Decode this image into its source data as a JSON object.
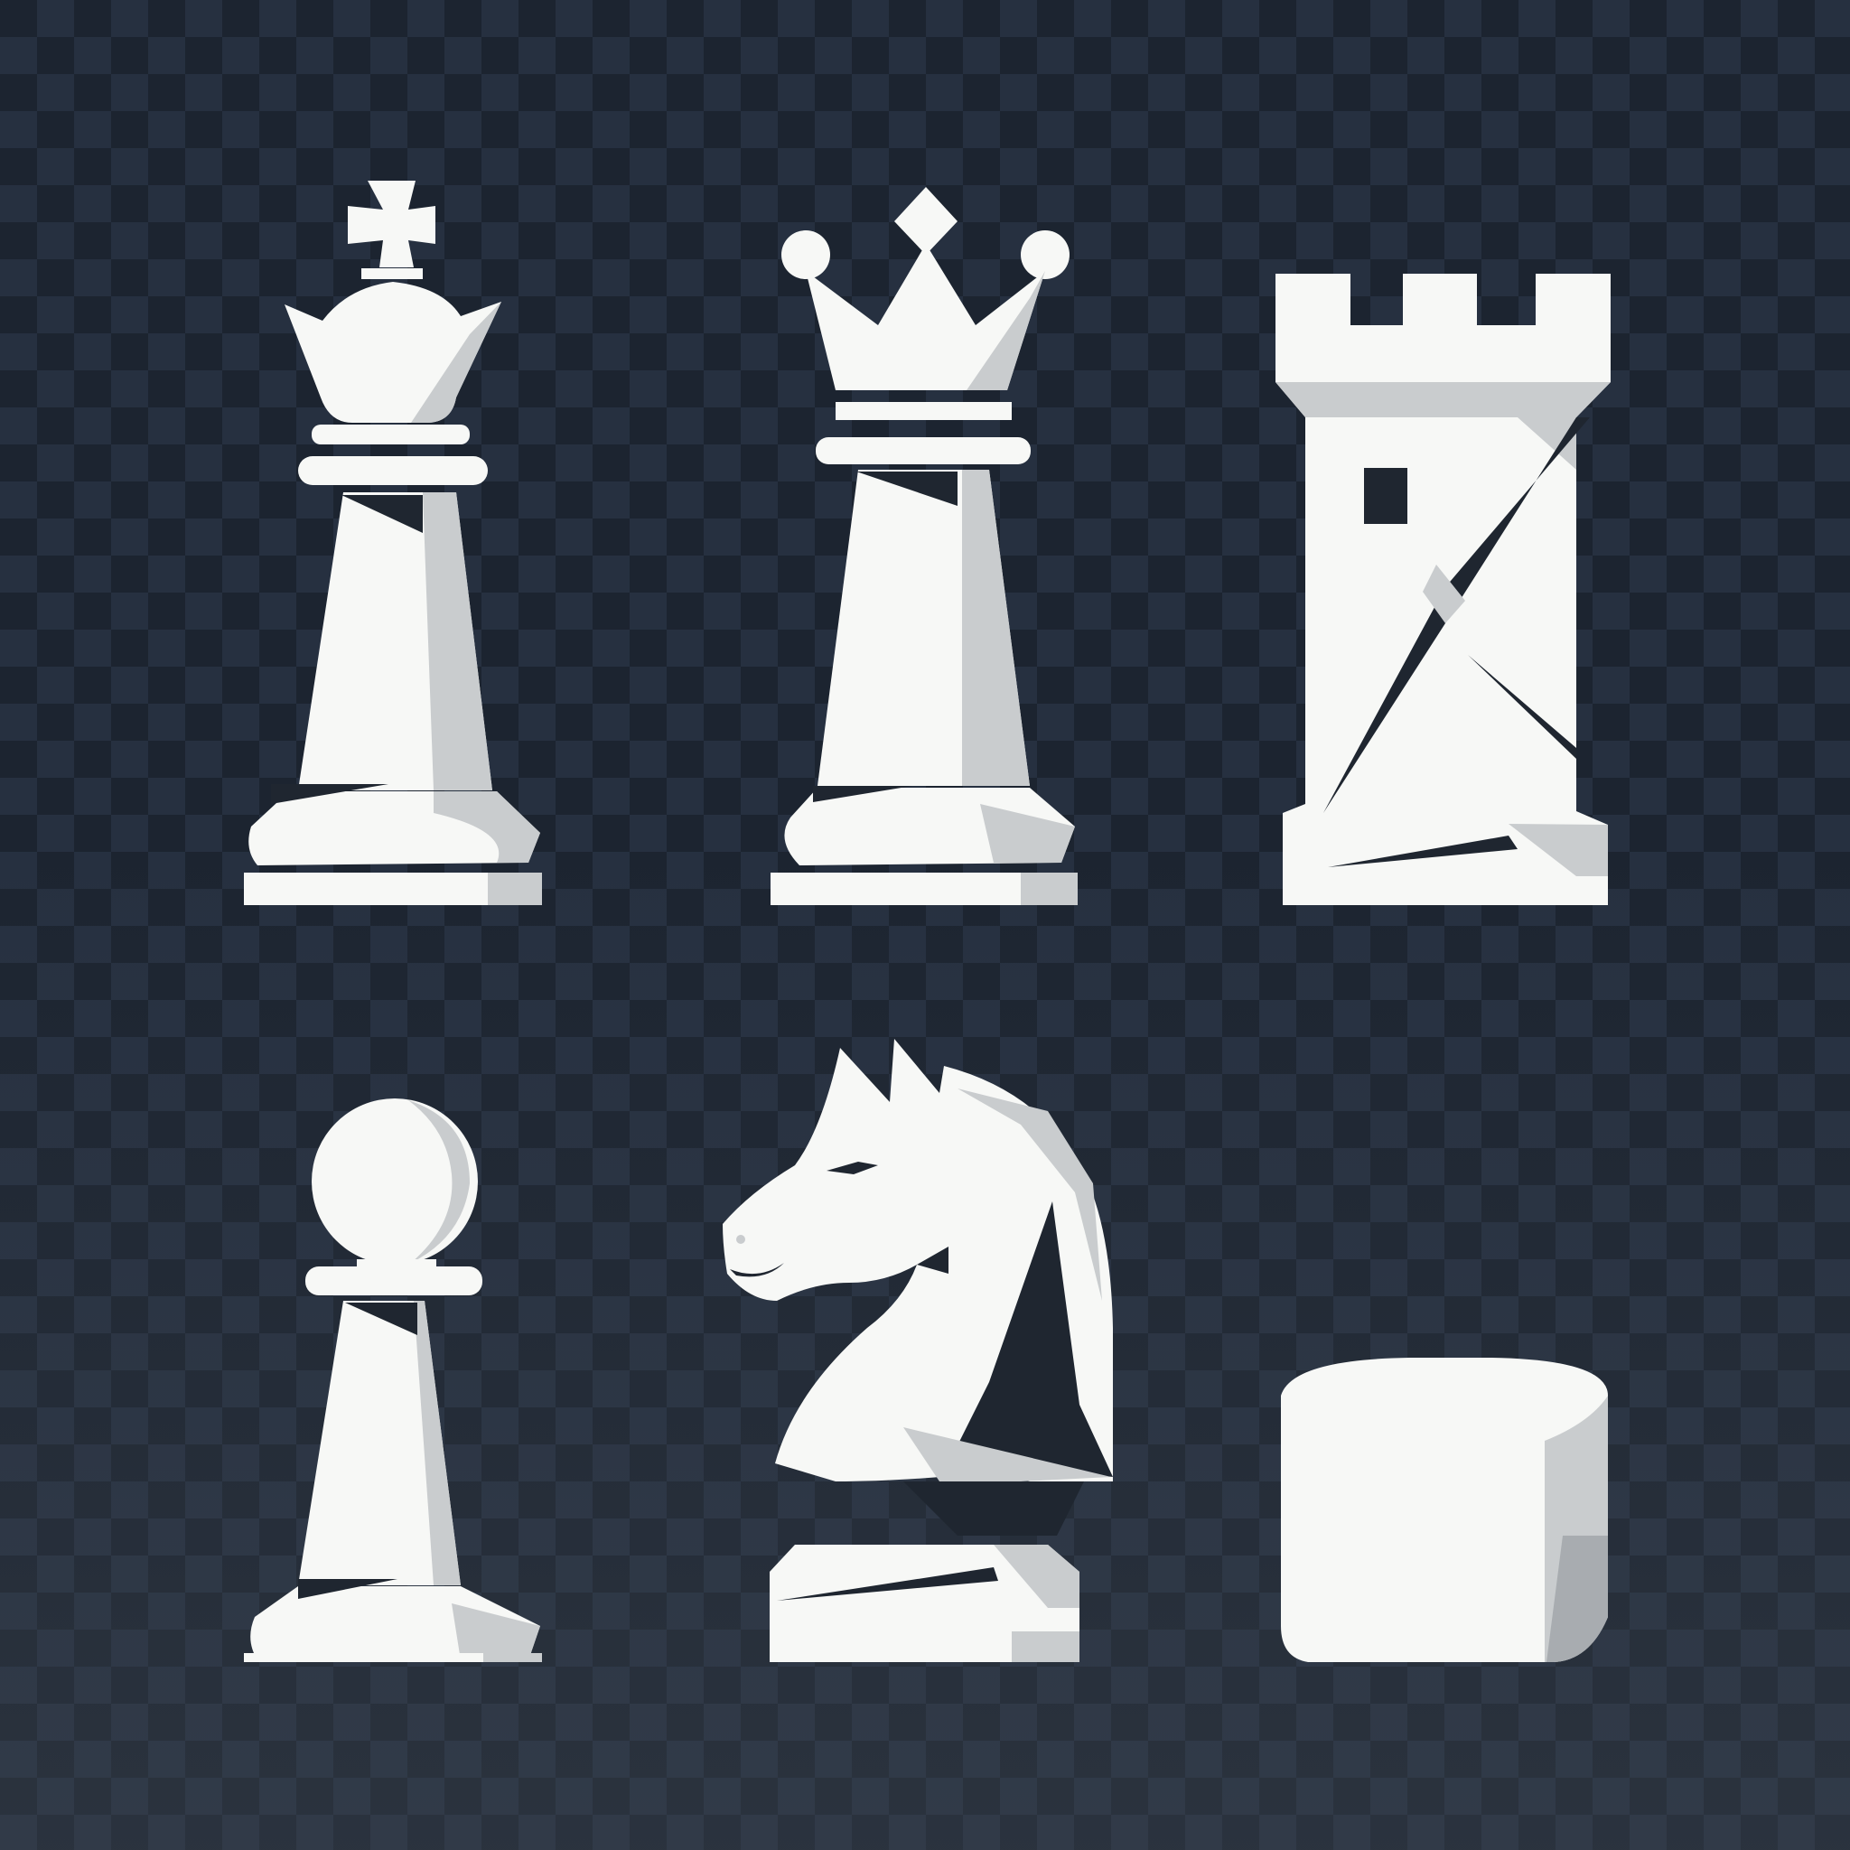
{
  "background": {
    "type": "checkerboard",
    "dark": "#1c2430",
    "light": "#263040",
    "fade_color": "#464e58"
  },
  "piece_colors": {
    "light": "#f7f8f6",
    "shade": "#c9ccce",
    "deep_shade": "#8d9298",
    "cutout": "#1f2630"
  },
  "pieces": [
    {
      "name": "king",
      "row": 1,
      "column": 1
    },
    {
      "name": "queen",
      "row": 1,
      "column": 2
    },
    {
      "name": "rook",
      "row": 1,
      "column": 3
    },
    {
      "name": "pawn",
      "row": 2,
      "column": 1
    },
    {
      "name": "knight",
      "row": 2,
      "column": 2
    },
    {
      "name": "blank-cylinder",
      "row": 2,
      "column": 3
    }
  ]
}
